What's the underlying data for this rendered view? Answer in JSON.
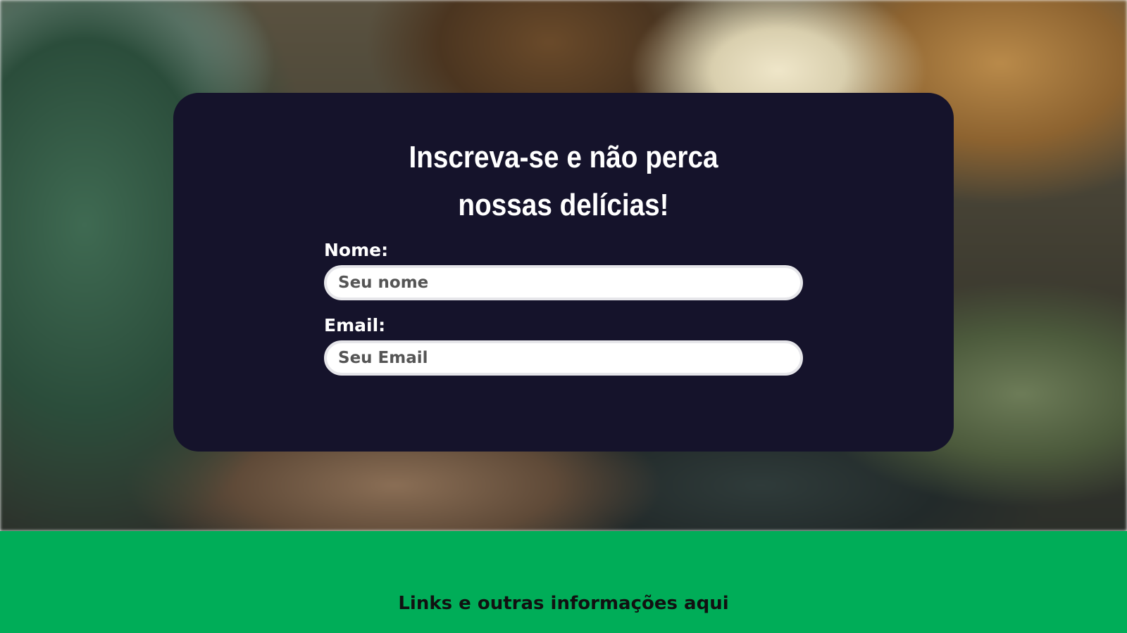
{
  "signup": {
    "title_line1": "Inscreva-se e não perca",
    "title_line2": "nossas delícias!",
    "name_label": "Nome:",
    "name_placeholder": "Seu nome",
    "email_label": "Email:",
    "email_placeholder": "Seu Email"
  },
  "footer": {
    "text": "Links e outras informações aqui"
  },
  "colors": {
    "card_background": "#15132b",
    "footer_background": "#00ad58",
    "input_border": "#e6e6ea"
  }
}
